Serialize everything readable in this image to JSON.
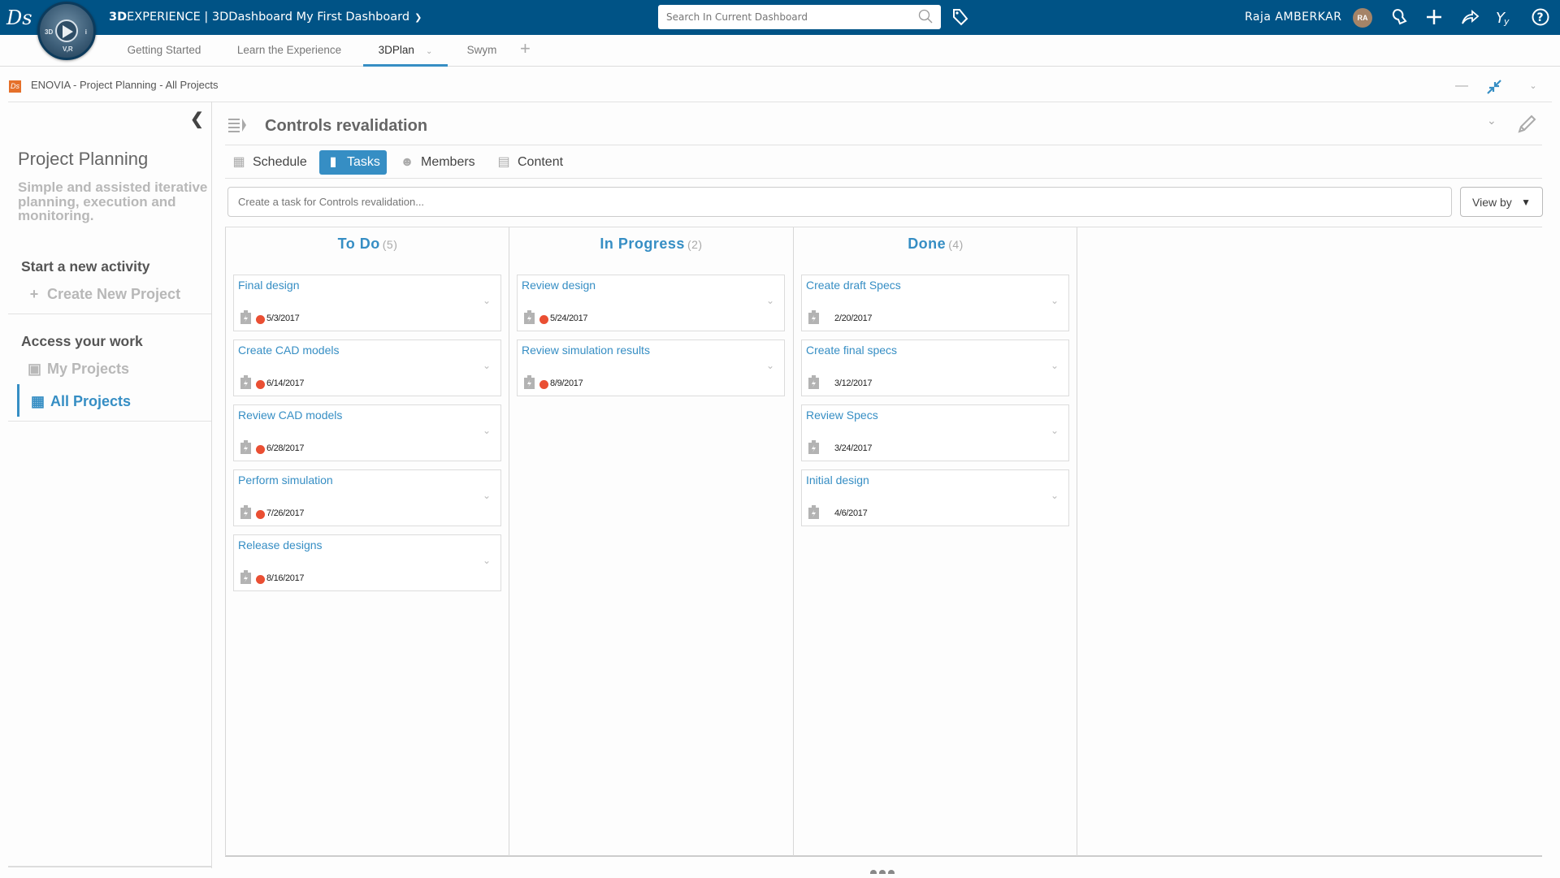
{
  "topbar": {
    "brand_bold": "3D",
    "brand_rest": "EXPERIENCE | 3DDashboard  My First Dashboard",
    "compass_labels": {
      "left": "3D",
      "right": "i",
      "bottom": "V,R"
    },
    "search_placeholder": "Search In Current Dashboard",
    "user_name": "Raja AMBERKAR",
    "user_initials": "RA",
    "icons": [
      "notifications-icon",
      "add-icon",
      "share-icon",
      "community-icon",
      "help-icon"
    ]
  },
  "tabs": [
    {
      "label": "Getting Started",
      "active": false
    },
    {
      "label": "Learn the Experience",
      "active": false
    },
    {
      "label": "3DPlan",
      "active": true
    },
    {
      "label": "Swym",
      "active": false
    }
  ],
  "breadcrumb": "ENOVIA - Project Planning - All Projects",
  "sidebar": {
    "title": "Project Planning",
    "description": "Simple and assisted iterative planning, execution and monitoring.",
    "section_new": "Start a new activity",
    "create_project": "Create New Project",
    "section_access": "Access your work",
    "my_projects": "My Projects",
    "all_projects": "All Projects"
  },
  "main": {
    "title": "Controls revalidation",
    "tabs": [
      {
        "label": "Schedule",
        "icon": "calendar-icon",
        "active": false
      },
      {
        "label": "Tasks",
        "icon": "clipboard-icon",
        "active": true
      },
      {
        "label": "Members",
        "icon": "members-icon",
        "active": false
      },
      {
        "label": "Content",
        "icon": "document-icon",
        "active": false
      }
    ],
    "task_input_placeholder": "Create a task for Controls revalidation...",
    "view_by": "View by"
  },
  "board": {
    "late_color": "#ea4f33",
    "columns": [
      {
        "title": "To Do",
        "count": "(5)",
        "cards": [
          {
            "name": "Final design",
            "date": "5/3/2017",
            "late": true
          },
          {
            "name": "Create CAD models",
            "date": "6/14/2017",
            "late": true
          },
          {
            "name": "Review CAD models",
            "date": "6/28/2017",
            "late": true
          },
          {
            "name": "Perform simulation",
            "date": "7/26/2017",
            "late": true
          },
          {
            "name": "Release designs",
            "date": "8/16/2017",
            "late": true
          }
        ]
      },
      {
        "title": "In Progress",
        "count": "(2)",
        "cards": [
          {
            "name": "Review design",
            "date": "5/24/2017",
            "late": true
          },
          {
            "name": "Review simulation results",
            "date": "8/9/2017",
            "late": true
          }
        ]
      },
      {
        "title": "Done",
        "count": "(4)",
        "cards": [
          {
            "name": "Create draft Specs",
            "date": "2/20/2017",
            "late": false
          },
          {
            "name": "Create final specs",
            "date": "3/12/2017",
            "late": false
          },
          {
            "name": "Review Specs",
            "date": "3/24/2017",
            "late": false
          },
          {
            "name": "Initial design",
            "date": "4/6/2017",
            "late": false
          }
        ]
      }
    ]
  }
}
